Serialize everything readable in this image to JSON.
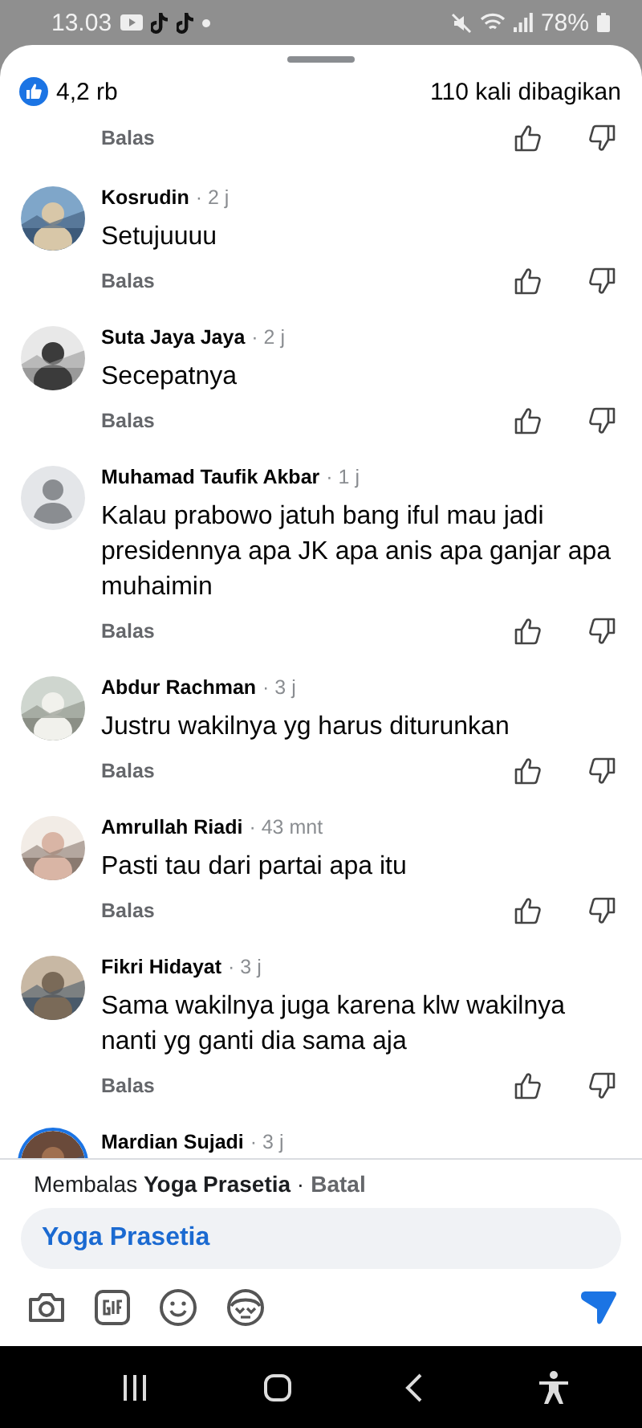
{
  "status_bar": {
    "time": "13.03",
    "battery": "78%"
  },
  "post_stats": {
    "reactions": "4,2 rb",
    "shares": "110 kali dibagikan"
  },
  "comments": [
    {
      "kind": "tail",
      "reply": "Balas"
    },
    {
      "kind": "comment",
      "default_avatar": false,
      "story": false,
      "name": "Kosrudin",
      "time": "· 2 j",
      "text": "Setujuuuu",
      "reply": "Balas"
    },
    {
      "kind": "comment",
      "default_avatar": false,
      "story": false,
      "name": "Suta Jaya Jaya",
      "time": "· 2 j",
      "text": "Secepatnya",
      "reply": "Balas"
    },
    {
      "kind": "comment",
      "default_avatar": true,
      "story": false,
      "name": "Muhamad Taufik Akbar",
      "time": "· 1 j",
      "text": "Kalau prabowo jatuh bang iful mau jadi presidennya apa JK apa anis apa ganjar apa muhaimin",
      "reply": "Balas"
    },
    {
      "kind": "comment",
      "default_avatar": false,
      "story": false,
      "name": "Abdur Rachman",
      "time": "· 3 j",
      "text": "Justru wakilnya yg harus diturunkan",
      "reply": "Balas"
    },
    {
      "kind": "comment",
      "default_avatar": false,
      "story": false,
      "name": "Amrullah Riadi",
      "time": "· 43 mnt",
      "text": "Pasti tau dari partai apa itu",
      "reply": "Balas"
    },
    {
      "kind": "comment",
      "default_avatar": false,
      "story": false,
      "name": "Fikri Hidayat",
      "time": "· 3 j",
      "text": "Sama wakilnya juga karena klw wakilnya nanti yg ganti dia sama aja",
      "reply": "Balas"
    },
    {
      "kind": "comment",
      "default_avatar": false,
      "story": true,
      "name": "Mardian Sujadi",
      "time": "· 3 j"
    }
  ],
  "composer": {
    "replying_to": "Membalas **Yoga Prasetia** ·",
    "cancel": "Batal",
    "value": "Yoga Prasetia"
  }
}
